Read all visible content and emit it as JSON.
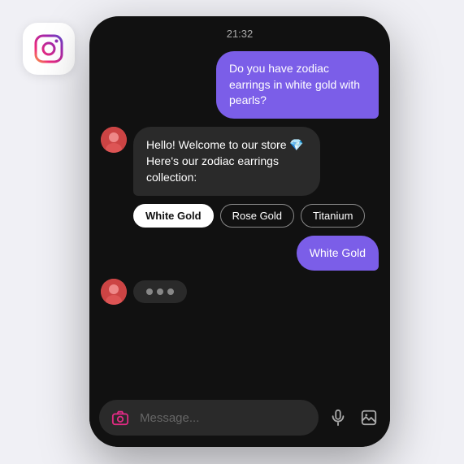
{
  "scene": {
    "background_color": "#f0f0f5"
  },
  "instagram_icon": {
    "aria_label": "Instagram"
  },
  "phone": {
    "status_bar": {
      "time": "21:32"
    },
    "messages": [
      {
        "id": "msg1",
        "type": "outgoing",
        "text": "Do you have zodiac earrings in white gold with pearls?"
      },
      {
        "id": "msg2",
        "type": "incoming",
        "text": "Hello! Welcome to our store 💎 Here's our zodiac earrings collection:"
      },
      {
        "id": "msg3",
        "type": "options",
        "options": [
          {
            "label": "White Gold",
            "selected": true
          },
          {
            "label": "Rose Gold",
            "selected": false
          },
          {
            "label": "Titanium",
            "selected": false
          }
        ]
      },
      {
        "id": "msg4",
        "type": "outgoing",
        "text": "White Gold"
      },
      {
        "id": "msg5",
        "type": "typing"
      }
    ],
    "input_bar": {
      "placeholder": "Message...",
      "camera_label": "camera",
      "mic_label": "microphone",
      "image_label": "image"
    }
  }
}
